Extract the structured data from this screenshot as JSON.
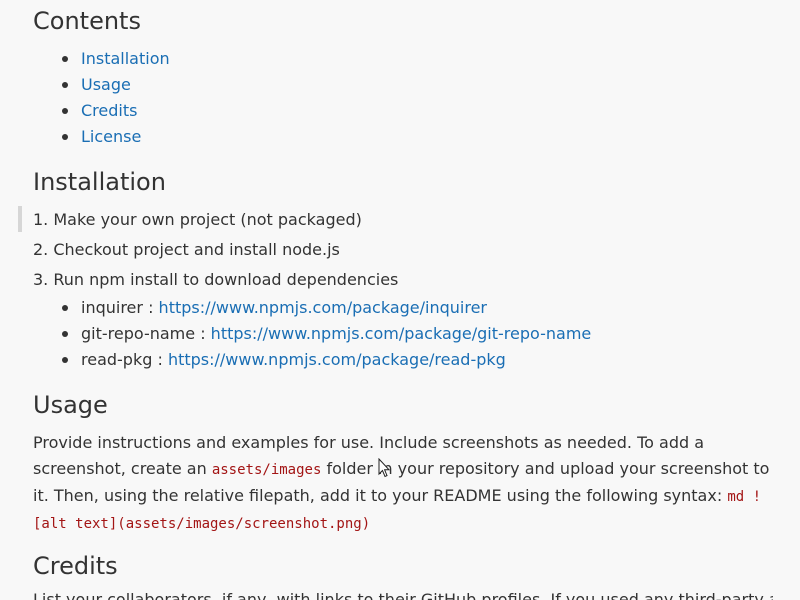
{
  "contents": {
    "heading": "Contents",
    "items": [
      "Installation",
      "Usage",
      "Credits",
      "License"
    ]
  },
  "installation": {
    "heading": "Installation",
    "steps": [
      "1. Make your own project (not packaged)",
      "2. Checkout project and install node.js",
      "3. Run npm install to download dependencies"
    ],
    "deps": [
      {
        "name": "inquirer : ",
        "url": "https://www.npmjs.com/package/inquirer"
      },
      {
        "name": "git-repo-name : ",
        "url": "https://www.npmjs.com/package/git-repo-name"
      },
      {
        "name": "read-pkg : ",
        "url": "https://www.npmjs.com/package/read-pkg"
      }
    ]
  },
  "usage": {
    "heading": "Usage",
    "text_1": "Provide instructions and examples for use. Include screenshots as needed. To add a screenshot, create an ",
    "code_1": "assets/images",
    "text_2": " folder in your repository and upload your screenshot to it. Then, using the relative filepath, add it to your README using the following syntax: ",
    "code_2": "md ![alt text](assets/images/screenshot.png)"
  },
  "credits": {
    "heading": "Credits",
    "text": "List your collaborators, if any, with links to their GitHub profiles. If you used any third-party assets"
  },
  "colors": {
    "background": "#f8f8f8",
    "text": "#333333",
    "link": "#1a6eb4",
    "code": "#a31515"
  }
}
